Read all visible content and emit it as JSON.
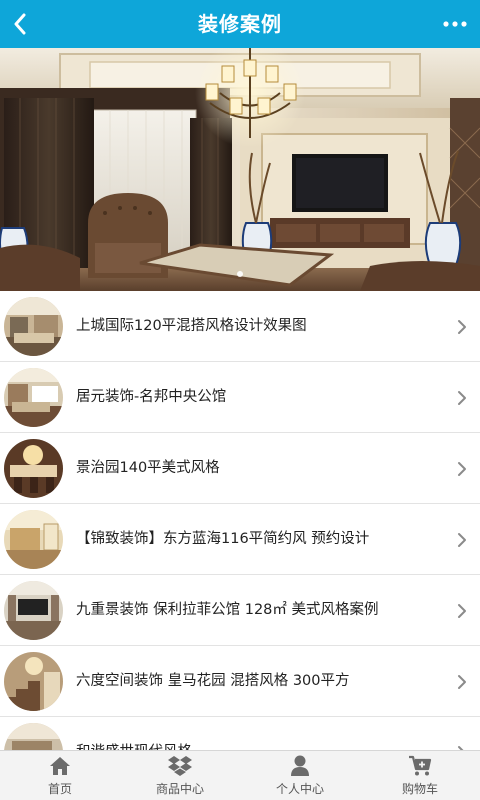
{
  "header": {
    "title": "装修案例",
    "back_icon": "back-chevron-icon",
    "more_icon": "more-dots-icon",
    "bg_color": "#0ea6d9"
  },
  "banner": {
    "slide_count": 1,
    "active_slide": 1
  },
  "list": {
    "items": [
      {
        "label": "上城国际120平混搭风格设计效果图",
        "thumb_icon": "living-room-thumbnail"
      },
      {
        "label": "居元装饰-名邦中央公馆",
        "thumb_icon": "living-room-thumbnail"
      },
      {
        "label": "景治园140平美式风格",
        "thumb_icon": "dining-room-thumbnail"
      },
      {
        "label": "【锦致装饰】东方蓝海116平简约风 预约设计",
        "thumb_icon": "bedroom-thumbnail"
      },
      {
        "label": "九重景装饰 保利拉菲公馆 128㎡ 美式风格案例",
        "thumb_icon": "living-room-thumbnail"
      },
      {
        "label": "六度空间装饰 皇马花园 混搭风格 300平方",
        "thumb_icon": "staircase-thumbnail"
      },
      {
        "label": "和谐盛世现代风格",
        "thumb_icon": "living-room-thumbnail"
      }
    ]
  },
  "tabbar": {
    "tabs": [
      {
        "label": "首页",
        "icon": "home-icon"
      },
      {
        "label": "商品中心",
        "icon": "dropbox-icon"
      },
      {
        "label": "个人中心",
        "icon": "person-icon"
      },
      {
        "label": "购物车",
        "icon": "cart-icon"
      }
    ]
  }
}
